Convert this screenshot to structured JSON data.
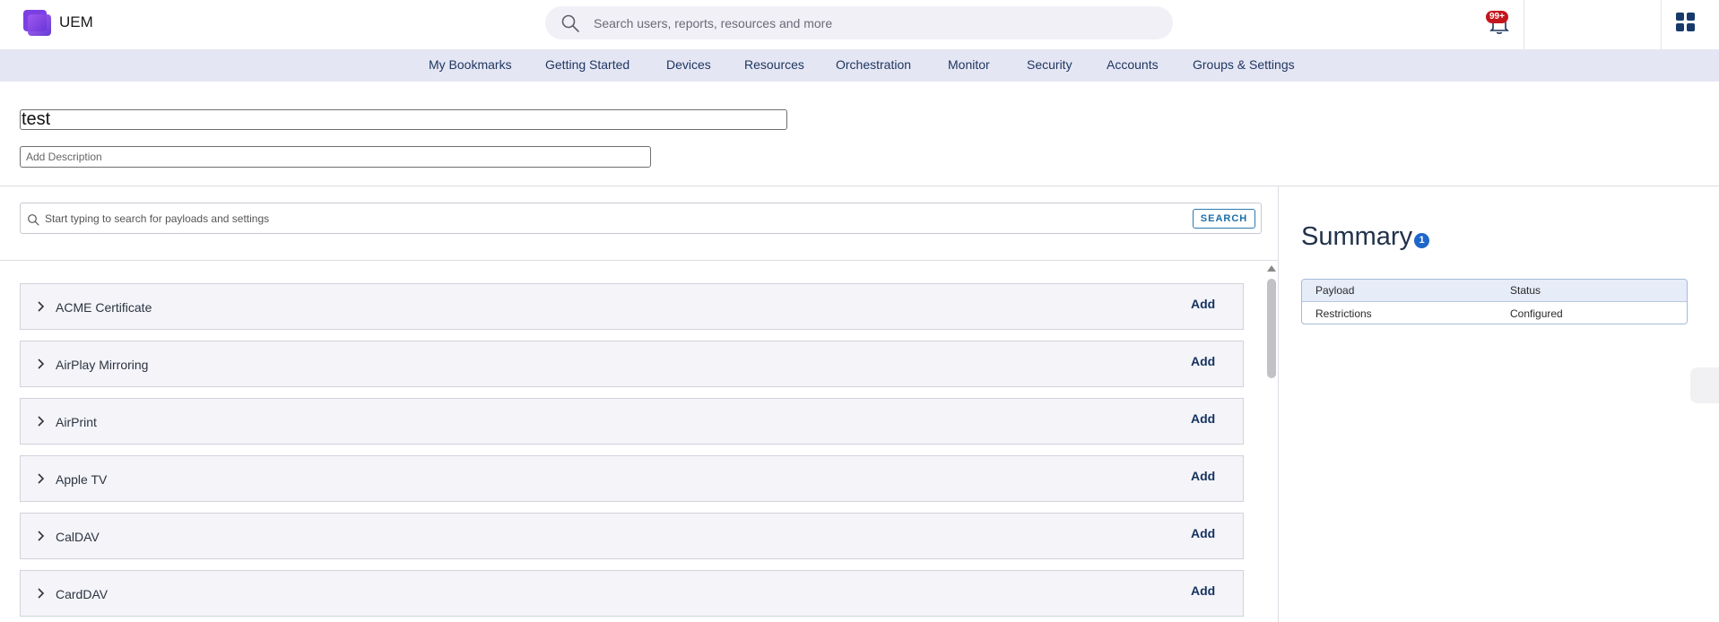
{
  "header": {
    "app_name": "UEM",
    "search_placeholder": "Search users, reports, resources and more",
    "notification_badge": "99+",
    "brand_color": "#7b3fe4"
  },
  "nav": {
    "items": [
      {
        "label": "My Bookmarks"
      },
      {
        "label": "Getting Started"
      },
      {
        "label": "Devices"
      },
      {
        "label": "Resources"
      },
      {
        "label": "Orchestration"
      },
      {
        "label": "Monitor"
      },
      {
        "label": "Security"
      },
      {
        "label": "Accounts"
      },
      {
        "label": "Groups & Settings"
      }
    ]
  },
  "profile": {
    "name_value": "test",
    "description_placeholder": "Add Description"
  },
  "payload_search": {
    "placeholder": "Start typing to search for payloads and settings",
    "button_label": "SEARCH"
  },
  "payloads": [
    {
      "name": "ACME Certificate",
      "action": "Add"
    },
    {
      "name": "AirPlay Mirroring",
      "action": "Add"
    },
    {
      "name": "AirPrint",
      "action": "Add"
    },
    {
      "name": "Apple TV",
      "action": "Add"
    },
    {
      "name": "CalDAV",
      "action": "Add"
    },
    {
      "name": "CardDAV",
      "action": "Add"
    }
  ],
  "summary": {
    "title": "Summary",
    "count": "1",
    "columns": [
      "Payload",
      "Status"
    ],
    "rows": [
      {
        "payload": "Restrictions",
        "status": "Configured"
      }
    ]
  }
}
